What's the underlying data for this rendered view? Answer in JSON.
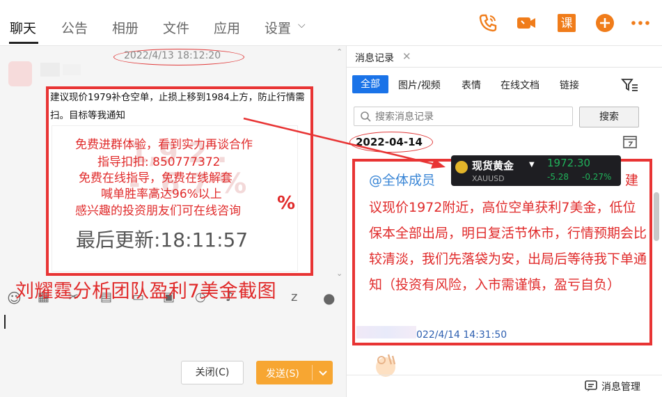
{
  "nav": {
    "tabs": [
      "聊天",
      "公告",
      "相册",
      "文件",
      "应用",
      "设置"
    ],
    "active_tab": "聊天"
  },
  "toolbar_icons": [
    "phone-icon",
    "video-call-icon",
    "course-icon",
    "add-icon",
    "more-icon"
  ],
  "course_icon_char": "课",
  "left": {
    "timestamp": "2022/4/13 18:12:20",
    "message_text": "建议现价1979补仓空单，止损上移到1984上方，防止行情需扫。目标等我通知",
    "screenshot": {
      "ghost_top": "1,9 2 .",
      "ghost_mid": "- ,6 7 %",
      "promo_lines": [
        "免费进群体验，看到实力再谈合作",
        "指导扣扣:  850777372",
        "免费在线指导，免费在线解套",
        "喊单胜率高达96%以上",
        "感兴趣的投资朋友们可在线咨询"
      ],
      "pct_symbol": "%",
      "last_update": "最后更新:18:11:57"
    },
    "caption": "刘耀霆分析团队盈利7美金截图",
    "close_button": "关闭(C)",
    "send_button": "发送(S)"
  },
  "right": {
    "panel_title": "消息记录",
    "filters": [
      "全部",
      "图片/视频",
      "表情",
      "在线文档",
      "链接"
    ],
    "search_placeholder": "搜索消息记录",
    "search_button": "搜索",
    "date": "2022-04-14",
    "ticker": {
      "name": "现货黄金",
      "symbol": "XAUUSD",
      "price": "1972.30",
      "change": "-5.28",
      "change_pct": "-0.27%"
    },
    "mention": "@全体成员",
    "msg_head": "建",
    "msg_body": "议现价1972附近，高位空单获利7美金，低位保本全部出局，明日复活节休市，行情预期会比较清淡，我们先落袋为安，出局后等待我下单通知（投资有风险，入市需谨慎，盈亏自负）",
    "msg_time": "022/4/14 14:31:50",
    "manage_label": "消息管理"
  },
  "colors": {
    "annotation_red": "#e83434",
    "send_orange": "#f7a632",
    "active_blue": "#1a73e8",
    "mention_blue": "#3a86d6",
    "icon_orange": "#f07c1a"
  }
}
